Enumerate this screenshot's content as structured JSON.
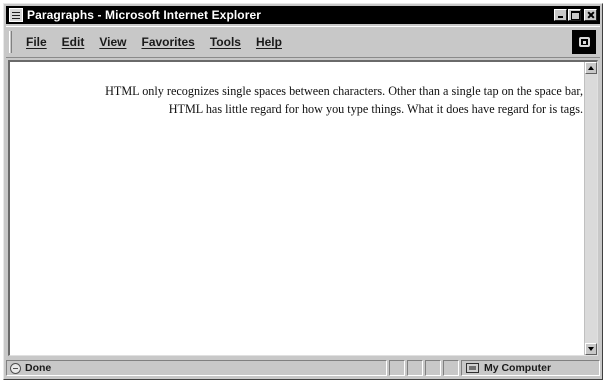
{
  "window": {
    "title": "Paragraphs - Microsoft Internet Explorer"
  },
  "menu": {
    "items": [
      "File",
      "Edit",
      "View",
      "Favorites",
      "Tools",
      "Help"
    ]
  },
  "content": {
    "paragraph": "HTML only recognizes single spaces between characters. Other than a single tap on the space bar, HTML has little regard for how you type things. What it does have regard for is tags."
  },
  "status": {
    "text": "Done",
    "zone": "My Computer"
  },
  "icons": {
    "app": "ie-page-icon",
    "throbber": "windows-logo-icon",
    "status_page": "page-done-icon",
    "zone": "my-computer-icon"
  }
}
